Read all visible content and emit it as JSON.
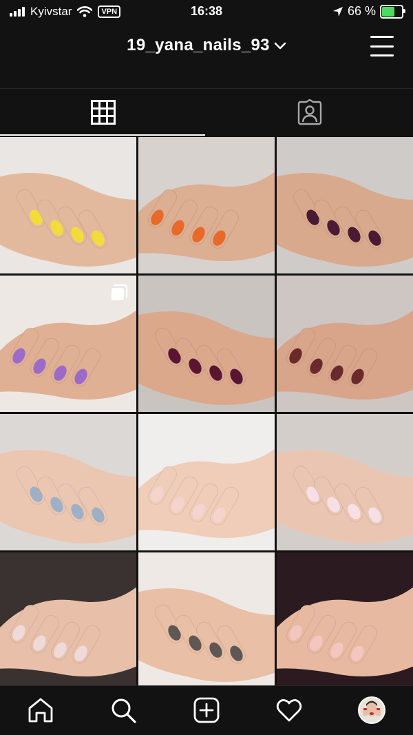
{
  "status_bar": {
    "carrier": "Kyivstar",
    "vpn_label": "VPN",
    "time": "16:38",
    "battery_percent_text": "66 %",
    "battery_level": 0.66
  },
  "profile": {
    "username": "19_yana_nails_93"
  },
  "tabs": [
    {
      "name": "grid",
      "icon": "grid-icon",
      "active": true
    },
    {
      "name": "tagged",
      "icon": "tagged-person-icon",
      "active": false
    }
  ],
  "posts": [
    {
      "bg": "#e9e6e4",
      "skin": "#e3b99e",
      "nail": "#f3dc3a",
      "multi": false
    },
    {
      "bg": "#d8d2cf",
      "skin": "#dcae92",
      "nail": "#e76a2a",
      "multi": false
    },
    {
      "bg": "#cfcbc8",
      "skin": "#d9a98d",
      "nail": "#4a1a35",
      "multi": false
    },
    {
      "bg": "#ede8e4",
      "skin": "#e0b094",
      "nail": "#9c6bc8",
      "multi": true
    },
    {
      "bg": "#c9c4c0",
      "skin": "#dba88c",
      "nail": "#5a1630",
      "multi": false
    },
    {
      "bg": "#cdc6c2",
      "skin": "#d9a58a",
      "nail": "#6a2a2a",
      "multi": false
    },
    {
      "bg": "#dcd8d6",
      "skin": "#ebc7b2",
      "nail": "#9fb0c6",
      "multi": false
    },
    {
      "bg": "#f0eded",
      "skin": "#efcdb9",
      "nail": "#f4d4cc",
      "multi": false
    },
    {
      "bg": "#d4cecb",
      "skin": "#eac6b2",
      "nail": "#f7dfe6",
      "multi": false
    },
    {
      "bg": "#3a3230",
      "skin": "#e8c0aa",
      "nail": "#eedad8",
      "multi": false
    },
    {
      "bg": "#efe9e6",
      "skin": "#e9bfa5",
      "nail": "#5e5754",
      "multi": false
    },
    {
      "bg": "#2b1a20",
      "skin": "#e7b9a1",
      "nail": "#f3c7bf",
      "multi": false
    }
  ],
  "nav": [
    {
      "name": "home",
      "icon": "home-icon"
    },
    {
      "name": "search",
      "icon": "search-icon"
    },
    {
      "name": "new-post",
      "icon": "add-post-icon"
    },
    {
      "name": "activity",
      "icon": "heart-icon"
    },
    {
      "name": "profile",
      "icon": "profile-avatar-icon"
    }
  ]
}
